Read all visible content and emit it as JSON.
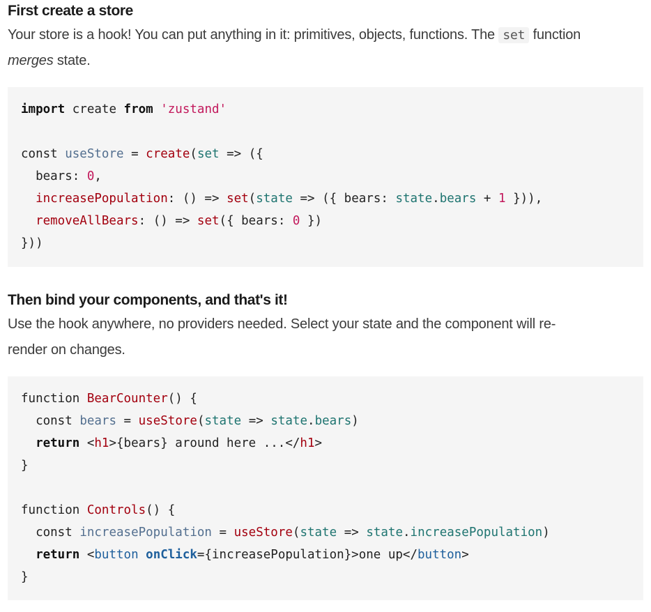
{
  "section1": {
    "title": "First create a store",
    "body_before": "Your store is a hook! You can put anything in it: primitives, objects, functions. The ",
    "inline_code": "set",
    "body_middle": " function ",
    "emphasis": "merges",
    "body_after": " state."
  },
  "code1": {
    "line1": {
      "kw_import": "import",
      "create": "create",
      "from": "from",
      "module": "'zustand'"
    },
    "line3": {
      "const": "const",
      "useStore": "useStore",
      "eq": "=",
      "create": "create",
      "paren": "(",
      "set": "set",
      "arrow": "=>",
      "open": "({"
    },
    "line4": {
      "bears": "bears:",
      "val": "0",
      "comma": ","
    },
    "line5": {
      "incr": "increasePopulation",
      "colon": ":",
      "arrowfn": "() =>",
      "set": "set",
      "paren": "(",
      "state": "state",
      "arrow": "=>",
      "obj": "({ bears:",
      "state2": "state",
      "dot": ".",
      "bears": "bears",
      "plus": "+",
      "one": "1",
      "close": "})),"
    },
    "line6": {
      "remove": "removeAllBears",
      "colon": ":",
      "arrowfn": "() =>",
      "set": "set",
      "open": "({ bears:",
      "zero": "0",
      "close": "})"
    },
    "line7": "}))"
  },
  "section2": {
    "title": "Then bind your components, and that's it!",
    "body_line1": "Use the hook anywhere, no providers needed. Select your state and the component will re-",
    "body_line2": "render on changes."
  },
  "code2": {
    "l1": {
      "function": "function",
      "name": "BearCounter",
      "rest": "() {"
    },
    "l2": {
      "const": "const",
      "bears": "bears",
      "eq": "=",
      "useStore": "useStore",
      "paren": "(",
      "state": "state",
      "arrow": "=>",
      "state2": "state",
      "dot": ".",
      "bears2": "bears",
      "close": ")"
    },
    "l3": {
      "return": "return",
      "lt": "<",
      "h1": "h1",
      "body": ">{bears} around here ...</",
      "h1b": "h1",
      "gt": ">"
    },
    "l4": "}",
    "l6": {
      "function": "function",
      "name": "Controls",
      "rest": "() {"
    },
    "l7": {
      "const": "const",
      "incr": "increasePopulation",
      "eq": "=",
      "useStore": "useStore",
      "paren": "(",
      "state": "state",
      "arrow": "=>",
      "state2": "state",
      "dot": ".",
      "incr2": "increasePopulation",
      "close": ")"
    },
    "l8": {
      "return": "return",
      "lt": "<",
      "button": "button",
      "onClick": "onClick",
      "attrval": "={increasePopulation}>one up</",
      "button2": "button",
      "gt": ">"
    },
    "l9": "}"
  }
}
